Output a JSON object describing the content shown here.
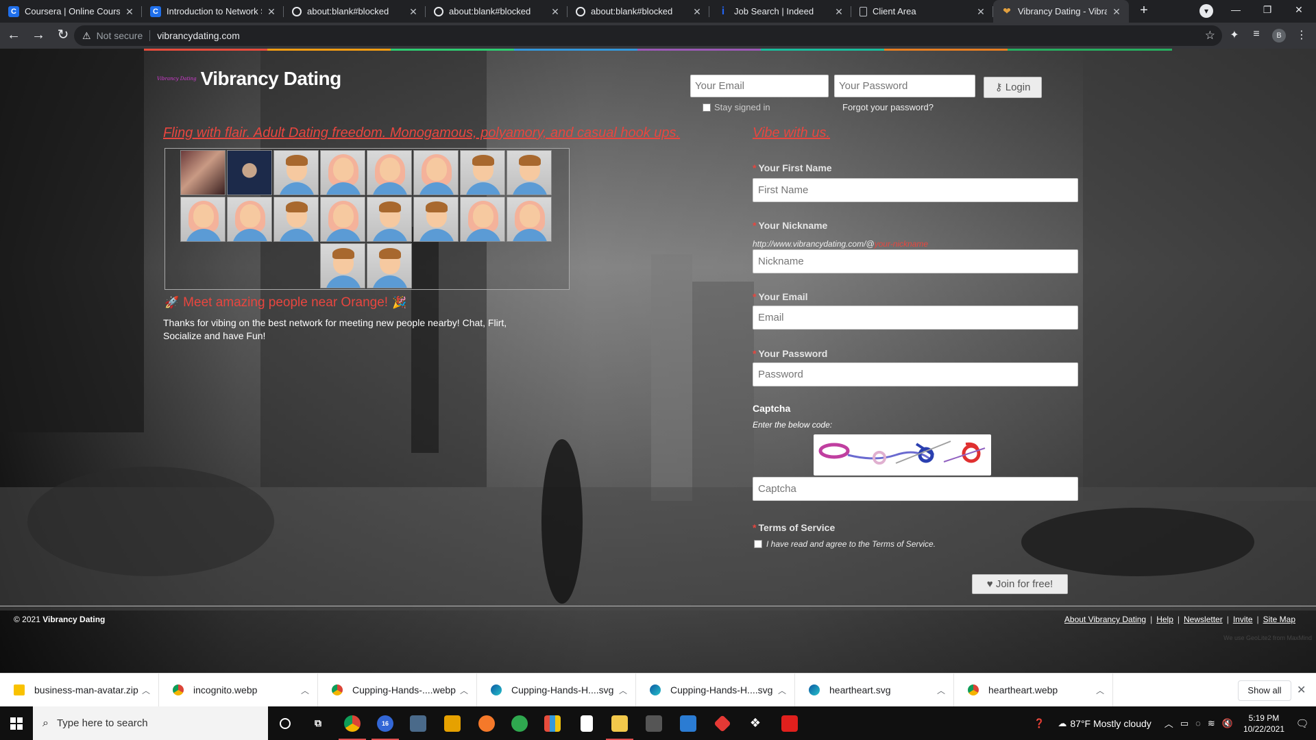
{
  "browser": {
    "tabs": [
      {
        "title": "Coursera | Online Courses",
        "favicon": "coursera-icon"
      },
      {
        "title": "Introduction to Network Se",
        "favicon": "coursera-icon"
      },
      {
        "title": "about:blank#blocked",
        "favicon": "globe-icon"
      },
      {
        "title": "about:blank#blocked",
        "favicon": "globe-icon"
      },
      {
        "title": "about:blank#blocked",
        "favicon": "globe-icon"
      },
      {
        "title": "Job Search | Indeed",
        "favicon": "indeed-icon"
      },
      {
        "title": "Client Area",
        "favicon": "document-icon"
      },
      {
        "title": "Vibrancy Dating - Vibrancy",
        "favicon": "heart-icon",
        "active": true
      }
    ],
    "address": {
      "security": "Not secure",
      "url": "vibrancydating.com"
    },
    "profile_initial": "B"
  },
  "page": {
    "logo_small": "Vibrancy Dating",
    "site_name": "Vibrancy Dating",
    "login": {
      "email_placeholder": "Your Email",
      "password_placeholder": "Your Password",
      "login_label": "Login",
      "stay_signed_in": "Stay signed in",
      "forgot": "Forgot your password?"
    },
    "tagline": "Fling with flair. Adult Dating freedom. Monogamous, polyamory, and casual hook ups.",
    "vibe_heading": "Vibe with us.",
    "gallery": [
      {
        "kind": "photo1"
      },
      {
        "kind": "photo2"
      },
      {
        "kind": "male"
      },
      {
        "kind": "female"
      },
      {
        "kind": "female"
      },
      {
        "kind": "female"
      },
      {
        "kind": "male"
      },
      {
        "kind": "male"
      },
      {
        "kind": "female"
      },
      {
        "kind": "female"
      },
      {
        "kind": "male"
      },
      {
        "kind": "female"
      },
      {
        "kind": "male"
      },
      {
        "kind": "male"
      },
      {
        "kind": "female"
      },
      {
        "kind": "female"
      },
      {
        "kind": "male"
      },
      {
        "kind": "male"
      }
    ],
    "meet_heading": "Meet amazing people near Orange!",
    "intro": "Thanks for vibing on the best network for meeting new people nearby! Chat, Flirt, Socialize and have Fun!",
    "signup": {
      "first_name_label": "Your First Name",
      "first_name_placeholder": "First Name",
      "nickname_label": "Your Nickname",
      "nickname_url_prefix": "http://www.vibrancydating.com/@",
      "nickname_url_placeholder": "your-nickname",
      "nickname_placeholder": "Nickname",
      "email_label": "Your Email",
      "email_placeholder": "Email",
      "password_label": "Your Password",
      "password_placeholder": "Password",
      "captcha_label": "Captcha",
      "captcha_hint": "Enter the below code:",
      "captcha_placeholder": "Captcha",
      "terms_label": "Terms of Service",
      "terms_agree": "I have read and agree to the Terms of Service.",
      "join_label": "Join for free!"
    },
    "footer": {
      "copyright_prefix": "© 2021",
      "copyright_name": "Vibrancy Dating",
      "links": [
        "About Vibrancy Dating",
        "Help",
        "Newsletter",
        "Invite",
        "Site Map"
      ],
      "geoip": "We use GeoLite2 from MaxMind"
    }
  },
  "downloads": {
    "items": [
      {
        "name": "business-man-avatar.zip",
        "icon": "zip-icon"
      },
      {
        "name": "incognito.webp",
        "icon": "chrome-icon"
      },
      {
        "name": "Cupping-Hands-....webp",
        "icon": "chrome-icon"
      },
      {
        "name": "Cupping-Hands-H....svg",
        "icon": "edge-icon"
      },
      {
        "name": "Cupping-Hands-H....svg",
        "icon": "edge-icon"
      },
      {
        "name": "heartheart.svg",
        "icon": "edge-icon"
      },
      {
        "name": "heartheart.webp",
        "icon": "chrome-icon"
      }
    ],
    "show_all": "Show all"
  },
  "taskbar": {
    "search_placeholder": "Type here to search",
    "chrome_badge": "16",
    "weather": "87°F  Mostly cloudy",
    "time": "5:19 PM",
    "date": "10/22/2021"
  },
  "colors": {
    "accent_red": "#e8463f",
    "brand_magenta": "#d63cd6"
  }
}
